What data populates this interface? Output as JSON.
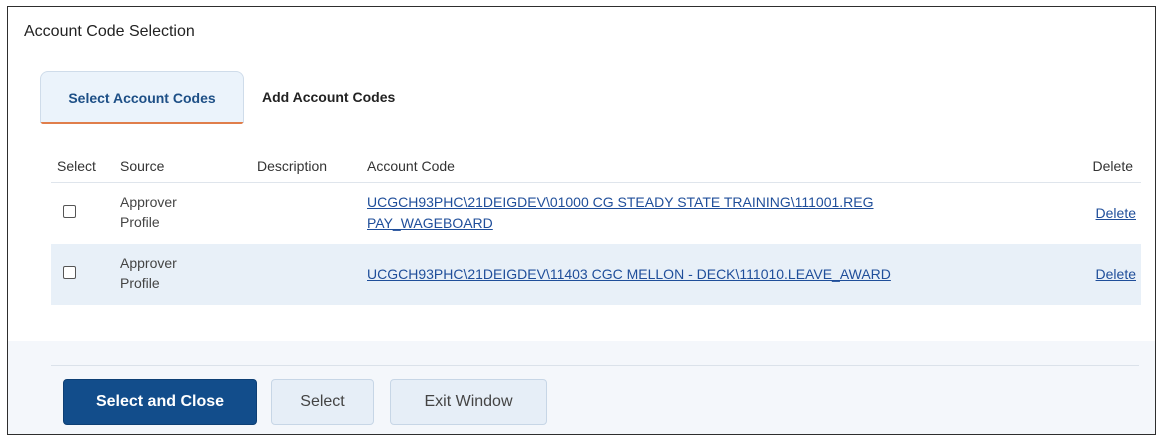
{
  "window": {
    "title": "Account Code Selection"
  },
  "tabs": [
    {
      "label": "Select Account Codes",
      "active": true
    },
    {
      "label": "Add Account Codes",
      "active": false
    }
  ],
  "table": {
    "columns": {
      "select": "Select",
      "source": "Source",
      "description": "Description",
      "account_code": "Account Code",
      "delete": "Delete"
    },
    "rows": [
      {
        "checked": false,
        "source": "Approver Profile",
        "description": "",
        "account_code_line1": "UCGCH93PHC\\21DEIGDEV\\01000 CG STEADY STATE TRAINING\\111001.REG",
        "account_code_line2": "PAY_WAGEBOARD",
        "delete_label": "Delete"
      },
      {
        "checked": false,
        "source": "Approver Profile",
        "description": "",
        "account_code": "UCGCH93PHC\\21DEIGDEV\\11403 CGC MELLON - DECK\\111010.LEAVE_AWARD",
        "delete_label": "Delete"
      }
    ]
  },
  "buttons": {
    "select_and_close": "Select and Close",
    "select": "Select",
    "exit_window": "Exit Window"
  },
  "colors": {
    "primary": "#124d8b",
    "link": "#1f4e9a",
    "active_tab_bg": "#ebf3fb",
    "active_tab_underline": "#e07e4b",
    "alt_row_bg": "#e8f0f8"
  }
}
